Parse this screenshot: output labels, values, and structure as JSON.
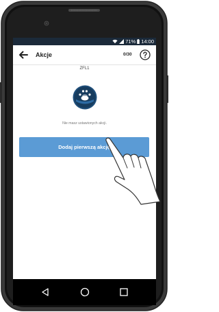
{
  "status_bar": {
    "battery": "71%",
    "time": "14:00"
  },
  "app_bar": {
    "title": "Akcje",
    "counter": "0/30"
  },
  "content": {
    "device_name": "ZFL1",
    "empty_message": "Nie masz ustawionych akcji.",
    "add_button": "Dodaj pierwszą akcję"
  },
  "icons": {
    "back": "arrow-left-icon",
    "help": "question-circle-icon",
    "device": "remote-device-icon",
    "nav_back": "triangle-back-icon",
    "nav_home": "circle-home-icon",
    "nav_recent": "square-recent-icon"
  },
  "colors": {
    "accent": "#5b9bd5",
    "status_bar": "#1b2a3a",
    "device_icon": "#1f4e7a"
  }
}
